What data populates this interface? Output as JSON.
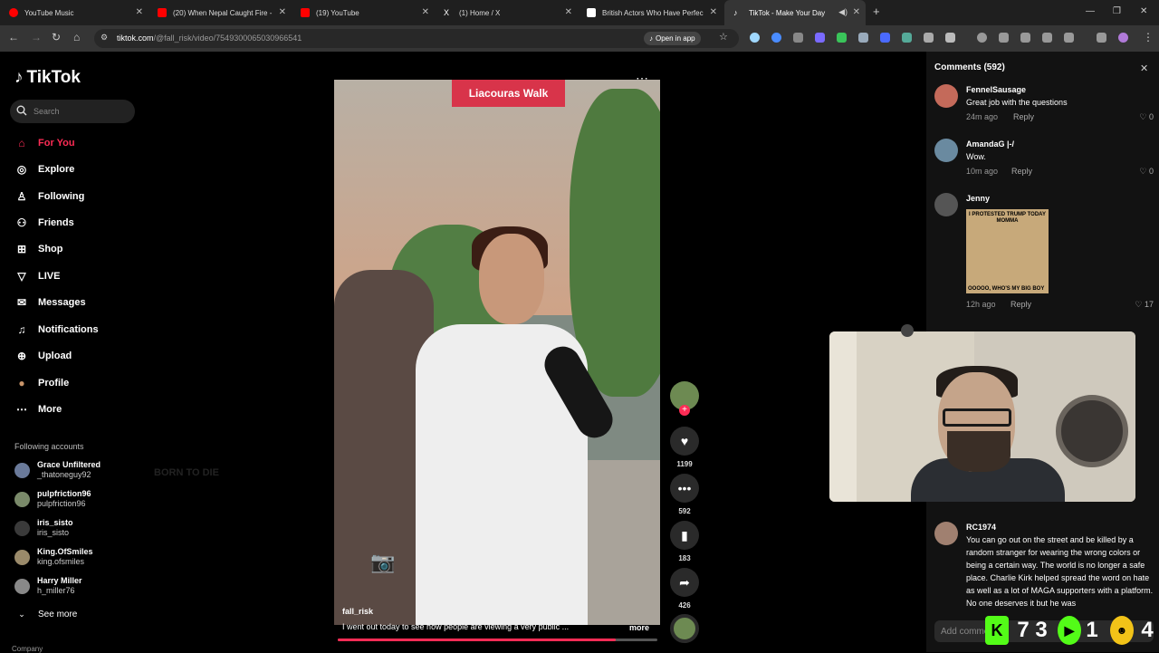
{
  "browser": {
    "tabs": [
      {
        "title": "YouTube Music",
        "color": "#ff0000"
      },
      {
        "title": "(20) When Nepal Caught Fire -",
        "color": "#ff0000"
      },
      {
        "title": "(19) YouTube",
        "color": "#ff0000"
      },
      {
        "title": "(1) Home / X",
        "color": "#ffffff"
      },
      {
        "title": "British Actors Who Have Perfec",
        "color": "#ffffff"
      },
      {
        "title": "TikTok - Make Your Day",
        "color": "#ffffff"
      }
    ],
    "new_tab": "+",
    "window_controls": {
      "minimize": "—",
      "restore": "❐",
      "close": "✕"
    },
    "url_host": "tiktok.com",
    "url_path": "/@fall_risk/video/7549300065030966541",
    "open_in_app": "Open in app"
  },
  "sidebar": {
    "logo": "TikTok",
    "search_placeholder": "Search",
    "nav": [
      {
        "label": "For You",
        "icon": "home-icon",
        "glyph": "⌂"
      },
      {
        "label": "Explore",
        "icon": "compass-icon",
        "glyph": "◎"
      },
      {
        "label": "Following",
        "icon": "following-icon",
        "glyph": "♙"
      },
      {
        "label": "Friends",
        "icon": "friends-icon",
        "glyph": "⚇"
      },
      {
        "label": "Shop",
        "icon": "shop-icon",
        "glyph": "⊞"
      },
      {
        "label": "LIVE",
        "icon": "live-icon",
        "glyph": "▽"
      },
      {
        "label": "Messages",
        "icon": "messages-icon",
        "glyph": "✉"
      },
      {
        "label": "Notifications",
        "icon": "bell-icon",
        "glyph": "♫"
      },
      {
        "label": "Upload",
        "icon": "upload-icon",
        "glyph": "⊕"
      },
      {
        "label": "Profile",
        "icon": "avatar-icon",
        "glyph": "●"
      },
      {
        "label": "More",
        "icon": "more-icon",
        "glyph": "⋯"
      }
    ],
    "following_title": "Following accounts",
    "following": [
      {
        "name": "Grace Unfiltered",
        "handle": "_thatoneguy92"
      },
      {
        "name": "pulpfriction96",
        "handle": "pulpfriction96"
      },
      {
        "name": "iris_sisto",
        "handle": "iris_sisto"
      },
      {
        "name": "King.OfSmiles",
        "handle": "king.ofsmiles"
      },
      {
        "name": "Harry Miller",
        "handle": "h_miller76"
      }
    ],
    "see_more": "See more",
    "company": "Company"
  },
  "video": {
    "sign_text": "Liacouras Walk",
    "shirt_text": "BORN TO DIE",
    "author": "fall_risk",
    "caption": "I went out today to see how people are viewing a very public ...",
    "more_label": "more",
    "progress": 0.87,
    "actions": {
      "likes": "1199",
      "comments": "592",
      "saves": "183",
      "shares": "426"
    }
  },
  "comments_panel": {
    "title": "Comments (592)",
    "reply_label": "Reply",
    "items": [
      {
        "user": "FennelSausage",
        "text": "Great job with the questions",
        "time": "24m ago",
        "likes": "0"
      },
      {
        "user": "AmandaG |-/",
        "text": "Wow.",
        "time": "10m ago",
        "likes": "0"
      },
      {
        "user": "Jenny",
        "meme_top": "I PROTESTED TRUMP TODAY MOMMA",
        "meme_bottom": "OOOOO, WHO'S MY BIG BOY",
        "time": "12h ago",
        "likes": "17"
      },
      {
        "user": "RC1974",
        "text": "You can go out on the street and be killed by a random stranger for wearing the wrong colors or being a certain way. The world is no longer a safe place. Charlie Kirk helped spread the word on hate as well as a lot of MAGA supporters with a platform. No one deserves it but he was"
      }
    ],
    "add_comment_placeholder": "Add comment..."
  },
  "overlay": {
    "badge_k": "K",
    "count_a": "7",
    "count_b": "3",
    "count_c": "1",
    "count_d": "4"
  },
  "colors": {
    "accent": "#fe2c55",
    "badge_green": "#53fc18"
  }
}
